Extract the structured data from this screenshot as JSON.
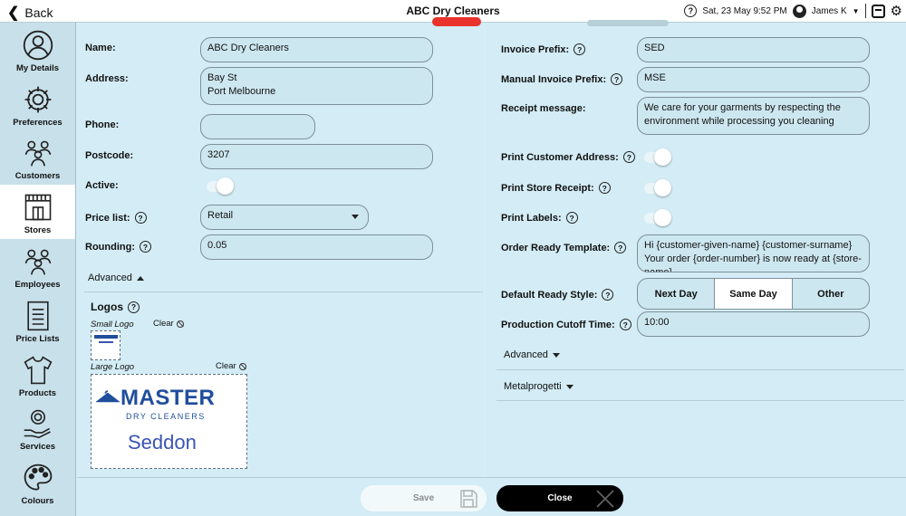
{
  "header": {
    "back_label": "Back",
    "title": "ABC Dry Cleaners",
    "datetime": "Sat, 23 May 9:52 PM",
    "user": "James K"
  },
  "sidebar": {
    "items": [
      {
        "label": "My Details",
        "icon": "person-icon"
      },
      {
        "label": "Preferences",
        "icon": "gear-icon"
      },
      {
        "label": "Customers",
        "icon": "customers-icon"
      },
      {
        "label": "Stores",
        "icon": "store-icon"
      },
      {
        "label": "Employees",
        "icon": "employees-icon"
      },
      {
        "label": "Price Lists",
        "icon": "price-list-icon"
      },
      {
        "label": "Products",
        "icon": "shirt-icon"
      },
      {
        "label": "Services",
        "icon": "services-icon"
      },
      {
        "label": "Colours",
        "icon": "palette-icon"
      }
    ],
    "active": "Stores"
  },
  "left": {
    "name_label": "Name:",
    "name_value": "ABC Dry Cleaners",
    "address_label": "Address:",
    "address_value": "Bay St\nPort Melbourne",
    "phone_label": "Phone:",
    "phone_value": "",
    "postcode_label": "Postcode:",
    "postcode_value": "3207",
    "active_label": "Active:",
    "active_on": true,
    "pricelist_label": "Price list:",
    "pricelist_value": "Retail",
    "rounding_label": "Rounding:",
    "rounding_value": "0.05",
    "advanced_label": "Advanced",
    "logos_title": "Logos",
    "small_logo_label": "Small Logo",
    "large_logo_label": "Large Logo",
    "clear_label": "Clear",
    "logo_text_main": "MASTER",
    "logo_text_sub": "DRY CLEANERS",
    "logo_text_store": "Seddon"
  },
  "right": {
    "invoice_prefix_label": "Invoice Prefix:",
    "invoice_prefix_value": "SED",
    "manual_prefix_label": "Manual Invoice Prefix:",
    "manual_prefix_value": "MSE",
    "receipt_label": "Receipt message:",
    "receipt_value": "We care for your garments by respecting the environment while processing you cleaning",
    "print_address_label": "Print Customer Address:",
    "print_receipt_label": "Print Store Receipt:",
    "print_labels_label": "Print Labels:",
    "order_ready_label": "Order Ready Template:",
    "order_ready_value": "Hi {customer-given-name} {customer-surname}\nYour order {order-number} is now ready at {store-name}",
    "ready_style_label": "Default Ready Style:",
    "ready_style_options": [
      "Next Day",
      "Same Day",
      "Other"
    ],
    "ready_style_selected": "Same Day",
    "cutoff_label": "Production Cutoff Time:",
    "cutoff_value": "10:00",
    "advanced_label": "Advanced",
    "metal_label": "Metalprogetti"
  },
  "footer": {
    "save_label": "Save",
    "close_label": "Close"
  },
  "colors": {
    "accent_red": "#e8322b",
    "background": "#d6eef6",
    "field": "#cde7f0"
  }
}
